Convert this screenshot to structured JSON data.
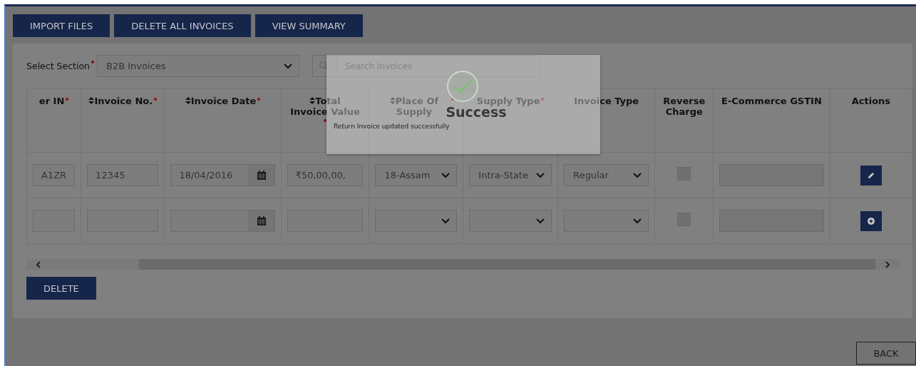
{
  "toolbar": {
    "buttons": [
      "IMPORT FILES",
      "DELETE ALL INVOICES",
      "VIEW SUMMARY"
    ]
  },
  "section_select": {
    "label": "Select Section",
    "required": true,
    "value": "B2B Invoices"
  },
  "search": {
    "placeholder": "Search Invoices"
  },
  "table": {
    "columns": [
      {
        "label": "er IN",
        "kind": "text",
        "sortable": false,
        "required": true
      },
      {
        "label": "Invoice No.",
        "kind": "text",
        "sortable": true,
        "required": true
      },
      {
        "label": "Invoice Date",
        "kind": "date",
        "sortable": true,
        "required": true
      },
      {
        "label": "Total Invoice Value",
        "kind": "text",
        "sortable": true,
        "required": true
      },
      {
        "label": "Place Of Supply",
        "kind": "select",
        "sortable": true,
        "required": true
      },
      {
        "label": "Supply Type",
        "kind": "select",
        "sortable": false,
        "required": true
      },
      {
        "label": "Invoice Type",
        "kind": "select",
        "sortable": false,
        "required": false
      },
      {
        "label": "Reverse Charge",
        "kind": "checkbox",
        "sortable": false,
        "required": false
      },
      {
        "label": "E-Commerce GSTIN",
        "kind": "gstin",
        "sortable": false,
        "required": false
      },
      {
        "label": "Actions",
        "kind": "action",
        "sortable": false,
        "required": false
      }
    ],
    "rows": [
      {
        "cells": [
          {
            "value": "A1ZR"
          },
          {
            "value": "12345"
          },
          {
            "value": "18/04/2016"
          },
          {
            "value": "₹50,00,00,"
          },
          {
            "value": "18-Assam"
          },
          {
            "value": "Intra-State"
          },
          {
            "value": "Regular"
          },
          {
            "checked": false
          },
          {},
          {
            "kind": "edit"
          }
        ]
      },
      {
        "cells": [
          {},
          {},
          {},
          {},
          {},
          {},
          {},
          {
            "checked": false
          },
          {},
          {
            "kind": "add"
          }
        ]
      }
    ]
  },
  "delete_button": "DELETE",
  "back_button": "BACK",
  "modal": {
    "title": "Success",
    "message": "Return Invoice updated successfully"
  }
}
